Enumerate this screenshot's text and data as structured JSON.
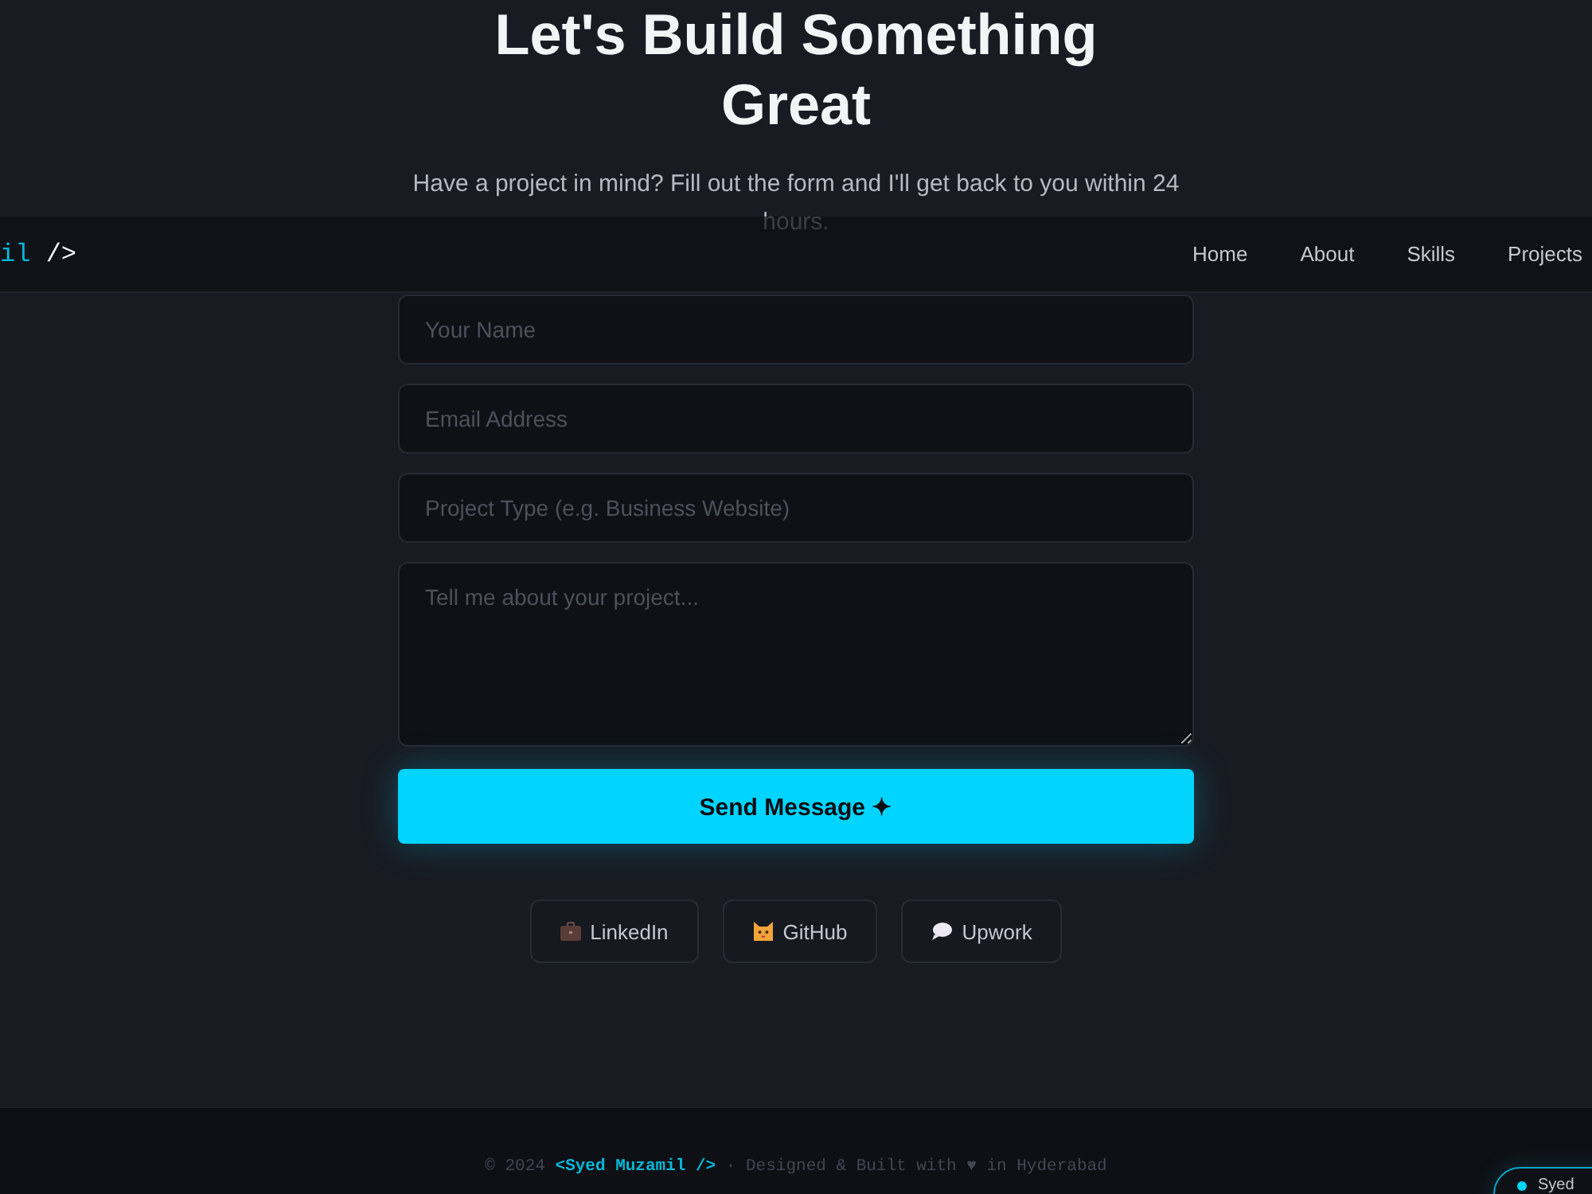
{
  "hero": {
    "title": "Let's Build Something Great",
    "subtitle": "Have a project in mind? Fill out the form and I'll get back to you within 24 hours."
  },
  "navbar": {
    "logo": {
      "accent": "il",
      "rest": "/>"
    },
    "links": [
      "Home",
      "About",
      "Skills",
      "Projects"
    ]
  },
  "form": {
    "fields": [
      {
        "kind": "input",
        "placeholder": "Your Name"
      },
      {
        "kind": "input",
        "placeholder": "Email Address"
      },
      {
        "kind": "input",
        "placeholder": "Project Type (e.g. Business Website)"
      },
      {
        "kind": "textarea",
        "placeholder": "Tell me about your project..."
      }
    ],
    "submit": "Send Message ✦"
  },
  "socials": [
    {
      "kind": "briefcase",
      "label": "LinkedIn"
    },
    {
      "kind": "cat",
      "label": "GitHub"
    },
    {
      "kind": "speech",
      "label": "Upwork"
    }
  ],
  "footer": {
    "prefix": "© 2024",
    "name": "<Syed Muzamil />",
    "suffix": "· Designed & Built with ♥ in Hyderabad"
  },
  "floating_badge": {
    "label": "Syed"
  }
}
